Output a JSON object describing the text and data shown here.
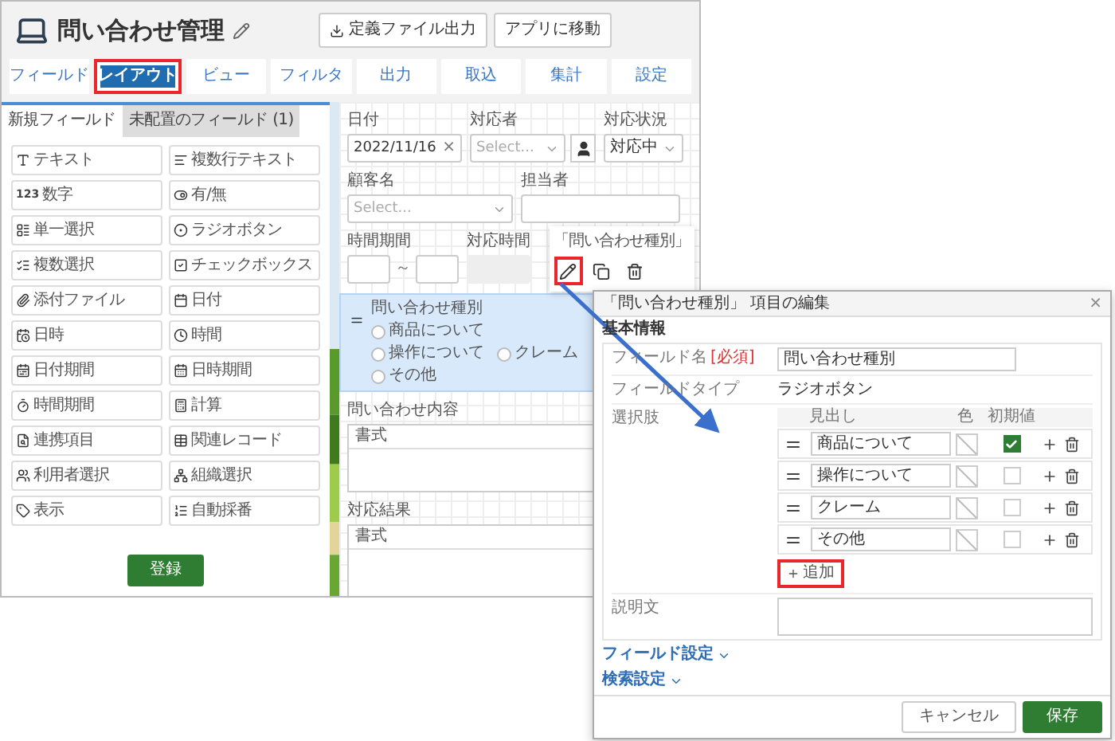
{
  "app": {
    "title": "問い合わせ管理",
    "buttons": [
      {
        "label": "定義ファイル出力",
        "kind": "export"
      },
      {
        "label": "アプリに移動",
        "kind": "plain"
      }
    ]
  },
  "tabs": [
    {
      "label": "フィールド",
      "selected": false,
      "highlighted": false
    },
    {
      "label": "レイアウト",
      "selected": true,
      "highlighted": true
    },
    {
      "label": "ビュー",
      "selected": false,
      "highlighted": false
    },
    {
      "label": "フィルタ",
      "selected": false,
      "highlighted": false
    },
    {
      "label": "出力",
      "selected": false,
      "highlighted": false
    },
    {
      "label": "取込",
      "selected": false,
      "highlighted": false
    },
    {
      "label": "集計",
      "selected": false,
      "highlighted": false
    },
    {
      "label": "設定",
      "selected": false,
      "highlighted": false
    }
  ],
  "palette": {
    "tabs": [
      {
        "label": "新規フィールド",
        "selected": true
      },
      {
        "label": "未配置のフィールド (1)",
        "selected": false
      }
    ],
    "items": [
      {
        "label": "テキスト",
        "kind": "text"
      },
      {
        "label": "複数行テキスト",
        "kind": "multiline"
      },
      {
        "label": "数字",
        "kind": "number",
        "icon_text": "123"
      },
      {
        "label": "有/無",
        "kind": "toggle"
      },
      {
        "label": "単一選択",
        "kind": "select"
      },
      {
        "label": "ラジオボタン",
        "kind": "radio"
      },
      {
        "label": "複数選択",
        "kind": "multiselect"
      },
      {
        "label": "チェックボックス",
        "kind": "checkbox"
      },
      {
        "label": "添付ファイル",
        "kind": "file"
      },
      {
        "label": "日付",
        "kind": "date"
      },
      {
        "label": "日時",
        "kind": "datetime"
      },
      {
        "label": "時間",
        "kind": "time"
      },
      {
        "label": "日付期間",
        "kind": "daterange"
      },
      {
        "label": "日時期間",
        "kind": "datetimerange"
      },
      {
        "label": "時間期間",
        "kind": "timerange"
      },
      {
        "label": "計算",
        "kind": "calc"
      },
      {
        "label": "連携項目",
        "kind": "lookup"
      },
      {
        "label": "関連レコード",
        "kind": "related"
      },
      {
        "label": "利用者選択",
        "kind": "user"
      },
      {
        "label": "組織選択",
        "kind": "org"
      },
      {
        "label": "表示",
        "kind": "label"
      },
      {
        "label": "自動採番",
        "kind": "autonumber"
      }
    ],
    "submit": "登録"
  },
  "form": {
    "rows": [
      [
        {
          "label": "日付",
          "kind": "date",
          "value": "2022/11/16",
          "clear": "×"
        },
        {
          "label": "対応者",
          "kind": "user_select",
          "placeholder": "Select..."
        },
        {
          "label": "対応状況",
          "kind": "select",
          "value": "対応中"
        }
      ],
      [
        {
          "label": "顧客名",
          "kind": "select",
          "placeholder": "Select..."
        },
        {
          "label": "担当者",
          "kind": "text"
        }
      ],
      [
        {
          "label": "時間期間",
          "kind": "range",
          "separator": "～"
        },
        {
          "label": "対応時間",
          "kind": "readonly"
        }
      ]
    ],
    "radio_field": {
      "label": "問い合わせ種別",
      "selected": true,
      "options": [
        {
          "label": "商品について",
          "selected": false
        },
        {
          "label": "操作について",
          "selected": false
        },
        {
          "label": "クレーム",
          "selected": false
        },
        {
          "label": "その他",
          "selected": false
        }
      ]
    },
    "rich_fields": [
      {
        "label": "問い合わせ内容",
        "toolbar": "書式"
      },
      {
        "label": "対応結果",
        "toolbar": "書式"
      }
    ],
    "popup": {
      "title": "「問い合わせ種別」",
      "actions": [
        {
          "kind": "edit",
          "highlighted": true
        },
        {
          "kind": "copy",
          "highlighted": false
        },
        {
          "kind": "delete",
          "highlighted": false
        }
      ]
    }
  },
  "dialog": {
    "title": "「問い合わせ種別」 項目の編集",
    "close": "×",
    "section": "基本情報",
    "name_row": {
      "label": "フィールド名",
      "required": "[必須]",
      "value": "問い合わせ種別"
    },
    "type_row": {
      "label": "フィールドタイプ",
      "value": "ラジオボタン"
    },
    "choices": {
      "label": "選択肢",
      "columns": [
        "見出し",
        "色",
        "初期値"
      ],
      "options": [
        {
          "label": "商品について",
          "default": true
        },
        {
          "label": "操作について",
          "default": false
        },
        {
          "label": "クレーム",
          "default": false
        },
        {
          "label": "その他",
          "default": false
        }
      ],
      "add": {
        "label": "追加",
        "highlighted": true
      }
    },
    "description": {
      "label": "説明文"
    },
    "sections": [
      "フィールド設定",
      "検索設定"
    ],
    "buttons": [
      {
        "label": "キャンセル",
        "kind": "secondary"
      },
      {
        "label": "保存",
        "kind": "primary"
      }
    ]
  }
}
